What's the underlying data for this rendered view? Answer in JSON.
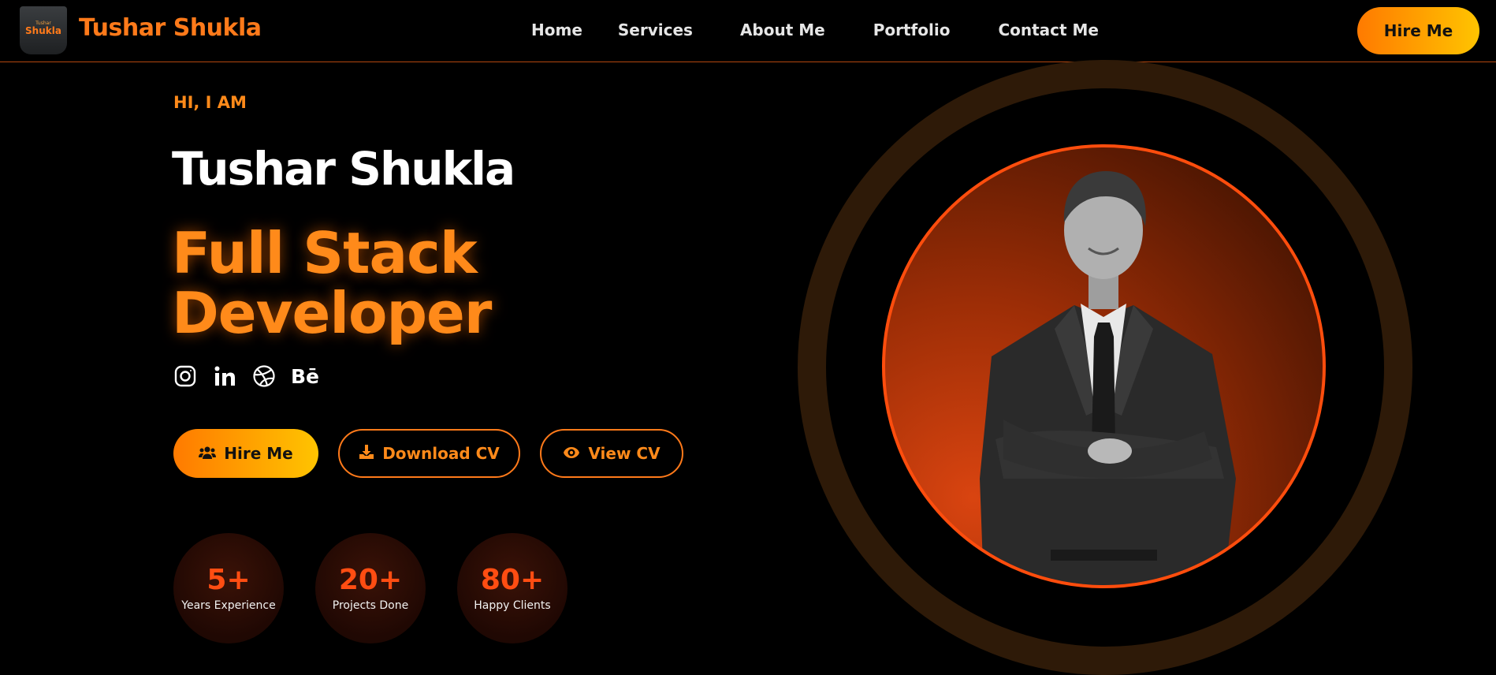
{
  "nav": {
    "logo_small": "Tushar",
    "logo_text": "Shukla",
    "site_name": "Tushar Shukla",
    "links": [
      "Home",
      "Services",
      "About Me",
      "Portfolio",
      "Contact Me"
    ],
    "hire_label": "Hire Me"
  },
  "hero": {
    "greeting": "HI, I AM",
    "name": "Tushar Shukla",
    "role_line1": "Full Stack",
    "role_line2": "Developer",
    "socials": [
      "instagram-icon",
      "linkedin-icon",
      "dribbble-icon",
      "behance-icon"
    ],
    "behance_text": "Bē",
    "buttons": {
      "hire": "Hire Me",
      "download": "Download CV",
      "view": "View CV"
    },
    "stats": [
      {
        "value": "5+",
        "label": "Years Experience"
      },
      {
        "value": "20+",
        "label": "Projects Done"
      },
      {
        "value": "80+",
        "label": "Happy Clients"
      }
    ]
  },
  "colors": {
    "accent": "#ff7a1a",
    "accent_red": "#ff4d12",
    "gradient_start": "#ff7a00",
    "gradient_end": "#ffc400",
    "background": "#000000"
  }
}
